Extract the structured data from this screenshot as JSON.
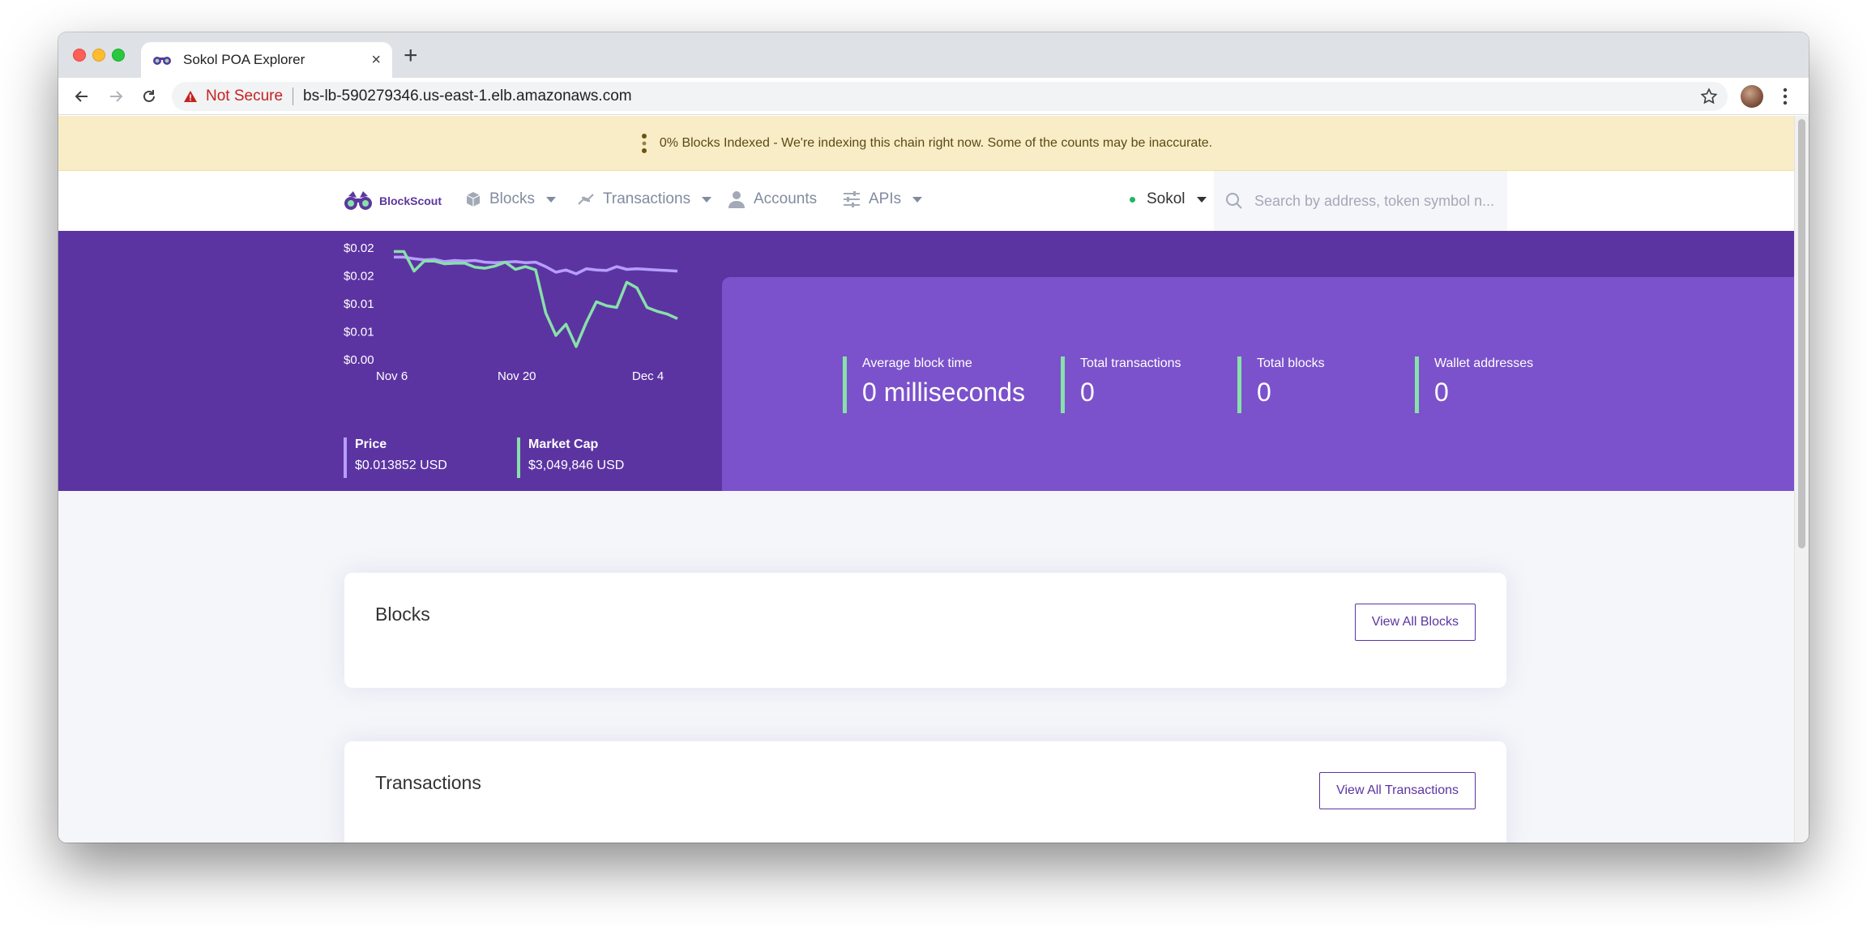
{
  "browser": {
    "tab_title": "Sokol POA Explorer",
    "tab_close": "×",
    "new_tab": "+",
    "security_label": "Not Secure",
    "url": "bs-lb-590279346.us-east-1.elb.amazonaws.com"
  },
  "banner": {
    "text": "0% Blocks Indexed - We're indexing this chain right now. Some of the counts may be inaccurate."
  },
  "nav": {
    "brand": "BlockScout",
    "items": [
      {
        "label": "Blocks",
        "icon": "cube-icon",
        "dropdown": true
      },
      {
        "label": "Transactions",
        "icon": "transfer-arrows-icon",
        "dropdown": true
      },
      {
        "label": "Accounts",
        "icon": "user-icon",
        "dropdown": false
      },
      {
        "label": "APIs",
        "icon": "sliders-icon",
        "dropdown": true
      }
    ],
    "network": "Sokol",
    "search_placeholder": "Search by address, token symbol n..."
  },
  "chart_data": {
    "type": "line",
    "x_tick_labels": [
      "Nov 6",
      "Nov 20",
      "Dec 4"
    ],
    "y_tick_labels": [
      "$0.02",
      "$0.02",
      "$0.01",
      "$0.01",
      "$0.00"
    ],
    "ylim": [
      0,
      0.02
    ],
    "x": [
      "Nov 6",
      "Nov 7",
      "Nov 8",
      "Nov 9",
      "Nov 10",
      "Nov 11",
      "Nov 12",
      "Nov 13",
      "Nov 14",
      "Nov 15",
      "Nov 16",
      "Nov 17",
      "Nov 18",
      "Nov 19",
      "Nov 20",
      "Nov 21",
      "Nov 22",
      "Nov 23",
      "Nov 24",
      "Nov 25",
      "Nov 26",
      "Nov 27",
      "Nov 28",
      "Nov 29",
      "Nov 30",
      "Dec 1",
      "Dec 2",
      "Dec 3",
      "Dec 4"
    ],
    "series": [
      {
        "name": "Price",
        "color": "#b79eff",
        "values": [
          0.0185,
          0.0185,
          0.0182,
          0.018,
          0.0181,
          0.0177,
          0.0179,
          0.0178,
          0.0179,
          0.0176,
          0.0175,
          0.0176,
          0.0177,
          0.0175,
          0.0176,
          0.0168,
          0.0158,
          0.0162,
          0.0155,
          0.0164,
          0.0162,
          0.0161,
          0.0168,
          0.0163,
          0.0164,
          0.0163,
          0.0162,
          0.0161,
          0.016
        ],
        "dates": "Nov 6 - Dec 4"
      },
      {
        "name": "Market Cap",
        "color": "#87e1a9",
        "values": [
          0.0195,
          0.0195,
          0.016,
          0.0178,
          0.0178,
          0.0173,
          0.0174,
          0.0174,
          0.0167,
          0.0165,
          0.0169,
          0.0176,
          0.0163,
          0.0168,
          0.0162,
          0.0085,
          0.0045,
          0.0065,
          0.0025,
          0.0068,
          0.0105,
          0.0098,
          0.0095,
          0.014,
          0.013,
          0.0095,
          0.0088,
          0.0083,
          0.0075
        ]
      }
    ]
  },
  "legend": {
    "price_label": "Price",
    "price_value": "$0.013852 USD",
    "market_cap_label": "Market Cap",
    "market_cap_value": "$3,049,846 USD"
  },
  "stats": [
    {
      "label": "Average block time",
      "value": "0 milliseconds"
    },
    {
      "label": "Total transactions",
      "value": "0"
    },
    {
      "label": "Total blocks",
      "value": "0"
    },
    {
      "label": "Wallet addresses",
      "value": "0"
    }
  ],
  "cards": {
    "blocks_title": "Blocks",
    "blocks_button": "View All Blocks",
    "transactions_title": "Transactions",
    "transactions_button": "View All Transactions"
  },
  "colors": {
    "brand_purple": "#5c34a2",
    "panel_purple": "#7b52cb",
    "accent_green": "#87e1a9",
    "accent_lavender": "#b79eff",
    "banner_bg": "#f9edc7"
  }
}
